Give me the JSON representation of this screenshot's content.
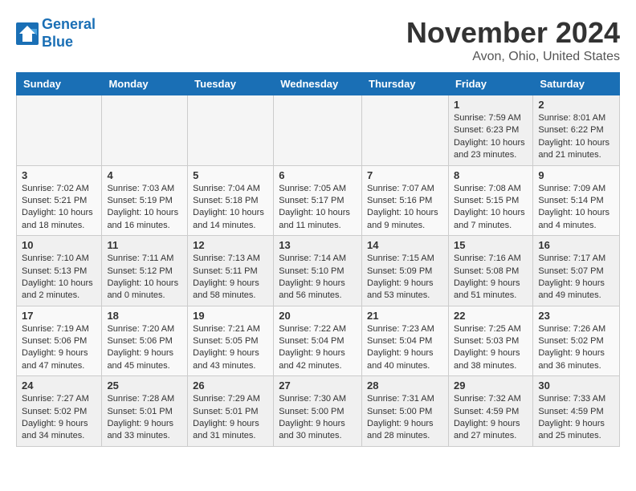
{
  "header": {
    "logo_line1": "General",
    "logo_line2": "Blue",
    "title": "November 2024",
    "location": "Avon, Ohio, United States"
  },
  "days_of_week": [
    "Sunday",
    "Monday",
    "Tuesday",
    "Wednesday",
    "Thursday",
    "Friday",
    "Saturday"
  ],
  "weeks": [
    [
      {
        "day": "",
        "info": ""
      },
      {
        "day": "",
        "info": ""
      },
      {
        "day": "",
        "info": ""
      },
      {
        "day": "",
        "info": ""
      },
      {
        "day": "",
        "info": ""
      },
      {
        "day": "1",
        "info": "Sunrise: 7:59 AM\nSunset: 6:23 PM\nDaylight: 10 hours and 23 minutes."
      },
      {
        "day": "2",
        "info": "Sunrise: 8:01 AM\nSunset: 6:22 PM\nDaylight: 10 hours and 21 minutes."
      }
    ],
    [
      {
        "day": "3",
        "info": "Sunrise: 7:02 AM\nSunset: 5:21 PM\nDaylight: 10 hours and 18 minutes."
      },
      {
        "day": "4",
        "info": "Sunrise: 7:03 AM\nSunset: 5:19 PM\nDaylight: 10 hours and 16 minutes."
      },
      {
        "day": "5",
        "info": "Sunrise: 7:04 AM\nSunset: 5:18 PM\nDaylight: 10 hours and 14 minutes."
      },
      {
        "day": "6",
        "info": "Sunrise: 7:05 AM\nSunset: 5:17 PM\nDaylight: 10 hours and 11 minutes."
      },
      {
        "day": "7",
        "info": "Sunrise: 7:07 AM\nSunset: 5:16 PM\nDaylight: 10 hours and 9 minutes."
      },
      {
        "day": "8",
        "info": "Sunrise: 7:08 AM\nSunset: 5:15 PM\nDaylight: 10 hours and 7 minutes."
      },
      {
        "day": "9",
        "info": "Sunrise: 7:09 AM\nSunset: 5:14 PM\nDaylight: 10 hours and 4 minutes."
      }
    ],
    [
      {
        "day": "10",
        "info": "Sunrise: 7:10 AM\nSunset: 5:13 PM\nDaylight: 10 hours and 2 minutes."
      },
      {
        "day": "11",
        "info": "Sunrise: 7:11 AM\nSunset: 5:12 PM\nDaylight: 10 hours and 0 minutes."
      },
      {
        "day": "12",
        "info": "Sunrise: 7:13 AM\nSunset: 5:11 PM\nDaylight: 9 hours and 58 minutes."
      },
      {
        "day": "13",
        "info": "Sunrise: 7:14 AM\nSunset: 5:10 PM\nDaylight: 9 hours and 56 minutes."
      },
      {
        "day": "14",
        "info": "Sunrise: 7:15 AM\nSunset: 5:09 PM\nDaylight: 9 hours and 53 minutes."
      },
      {
        "day": "15",
        "info": "Sunrise: 7:16 AM\nSunset: 5:08 PM\nDaylight: 9 hours and 51 minutes."
      },
      {
        "day": "16",
        "info": "Sunrise: 7:17 AM\nSunset: 5:07 PM\nDaylight: 9 hours and 49 minutes."
      }
    ],
    [
      {
        "day": "17",
        "info": "Sunrise: 7:19 AM\nSunset: 5:06 PM\nDaylight: 9 hours and 47 minutes."
      },
      {
        "day": "18",
        "info": "Sunrise: 7:20 AM\nSunset: 5:06 PM\nDaylight: 9 hours and 45 minutes."
      },
      {
        "day": "19",
        "info": "Sunrise: 7:21 AM\nSunset: 5:05 PM\nDaylight: 9 hours and 43 minutes."
      },
      {
        "day": "20",
        "info": "Sunrise: 7:22 AM\nSunset: 5:04 PM\nDaylight: 9 hours and 42 minutes."
      },
      {
        "day": "21",
        "info": "Sunrise: 7:23 AM\nSunset: 5:04 PM\nDaylight: 9 hours and 40 minutes."
      },
      {
        "day": "22",
        "info": "Sunrise: 7:25 AM\nSunset: 5:03 PM\nDaylight: 9 hours and 38 minutes."
      },
      {
        "day": "23",
        "info": "Sunrise: 7:26 AM\nSunset: 5:02 PM\nDaylight: 9 hours and 36 minutes."
      }
    ],
    [
      {
        "day": "24",
        "info": "Sunrise: 7:27 AM\nSunset: 5:02 PM\nDaylight: 9 hours and 34 minutes."
      },
      {
        "day": "25",
        "info": "Sunrise: 7:28 AM\nSunset: 5:01 PM\nDaylight: 9 hours and 33 minutes."
      },
      {
        "day": "26",
        "info": "Sunrise: 7:29 AM\nSunset: 5:01 PM\nDaylight: 9 hours and 31 minutes."
      },
      {
        "day": "27",
        "info": "Sunrise: 7:30 AM\nSunset: 5:00 PM\nDaylight: 9 hours and 30 minutes."
      },
      {
        "day": "28",
        "info": "Sunrise: 7:31 AM\nSunset: 5:00 PM\nDaylight: 9 hours and 28 minutes."
      },
      {
        "day": "29",
        "info": "Sunrise: 7:32 AM\nSunset: 4:59 PM\nDaylight: 9 hours and 27 minutes."
      },
      {
        "day": "30",
        "info": "Sunrise: 7:33 AM\nSunset: 4:59 PM\nDaylight: 9 hours and 25 minutes."
      }
    ]
  ]
}
